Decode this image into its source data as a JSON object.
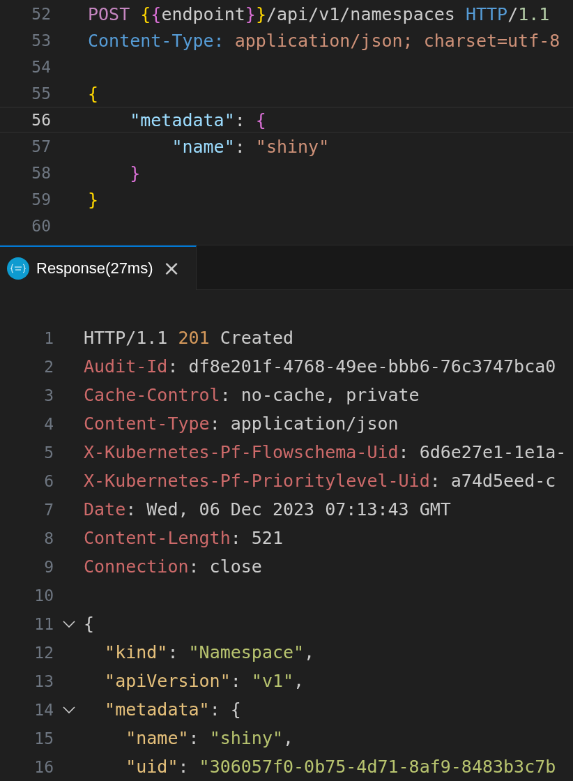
{
  "request_editor": {
    "lines": [
      {
        "number": "52",
        "current": false,
        "tokens": [
          {
            "kind": "keyword",
            "text": "POST "
          },
          {
            "kind": "brace1",
            "text": "{"
          },
          {
            "kind": "brace2",
            "text": "{"
          },
          {
            "kind": "plain",
            "text": "endpoint"
          },
          {
            "kind": "brace2",
            "text": "}"
          },
          {
            "kind": "brace1",
            "text": "}"
          },
          {
            "kind": "plain",
            "text": "/api/v1/namespaces "
          },
          {
            "kind": "type",
            "text": "HTTP"
          },
          {
            "kind": "plain",
            "text": "/"
          },
          {
            "kind": "number",
            "text": "1.1"
          }
        ]
      },
      {
        "number": "53",
        "current": false,
        "tokens": [
          {
            "kind": "type",
            "text": "Content-Type: "
          },
          {
            "kind": "string",
            "text": "application/json; charset=utf-8"
          }
        ]
      },
      {
        "number": "54",
        "current": false
      },
      {
        "number": "55",
        "current": false,
        "tokens": [
          {
            "kind": "brace1",
            "text": "{"
          }
        ]
      },
      {
        "number": "56",
        "current": true,
        "tokens": [
          {
            "kind": "key",
            "text": "    \"metadata\""
          },
          {
            "kind": "plain",
            "text": ": "
          },
          {
            "kind": "brace2",
            "text": "{"
          }
        ]
      },
      {
        "number": "57",
        "current": false,
        "tokens": [
          {
            "kind": "key",
            "text": "        \"name\""
          },
          {
            "kind": "plain",
            "text": ": "
          },
          {
            "kind": "string",
            "text": "\"shiny\""
          }
        ]
      },
      {
        "number": "58",
        "current": false,
        "tokens": [
          {
            "kind": "brace2",
            "text": "    }"
          }
        ]
      },
      {
        "number": "59",
        "current": false,
        "tokens": [
          {
            "kind": "brace1",
            "text": "}"
          }
        ]
      },
      {
        "number": "60",
        "current": false
      }
    ]
  },
  "tabs": [
    {
      "label": "Response(27ms)",
      "close": "×",
      "selected": true
    }
  ],
  "response_editor": {
    "lines": [
      {
        "number": "1",
        "tokens": [
          {
            "kind": "plain",
            "text": "HTTP/1.1 "
          },
          {
            "kind": "status",
            "text": "201"
          },
          {
            "kind": "plain",
            "text": " Created"
          }
        ]
      },
      {
        "number": "2",
        "tokens": [
          {
            "kind": "header",
            "text": "Audit-Id"
          },
          {
            "kind": "plain",
            "text": ": df8e201f-4768-49ee-bbb6-76c3747bca0"
          }
        ]
      },
      {
        "number": "3",
        "tokens": [
          {
            "kind": "header",
            "text": "Cache-Control"
          },
          {
            "kind": "plain",
            "text": ": no-cache, private"
          }
        ]
      },
      {
        "number": "4",
        "tokens": [
          {
            "kind": "header",
            "text": "Content-Type"
          },
          {
            "kind": "plain",
            "text": ": application/json"
          }
        ]
      },
      {
        "number": "5",
        "tokens": [
          {
            "kind": "header",
            "text": "X-Kubernetes-Pf-Flowschema-Uid"
          },
          {
            "kind": "plain",
            "text": ": 6d6e27e1-1e1a-"
          }
        ]
      },
      {
        "number": "6",
        "tokens": [
          {
            "kind": "header",
            "text": "X-Kubernetes-Pf-Prioritylevel-Uid"
          },
          {
            "kind": "plain",
            "text": ": a74d5eed-c"
          }
        ]
      },
      {
        "number": "7",
        "tokens": [
          {
            "kind": "header",
            "text": "Date"
          },
          {
            "kind": "plain",
            "text": ": Wed, 06 Dec 2023 07:13:43 GMT"
          }
        ]
      },
      {
        "number": "8",
        "tokens": [
          {
            "kind": "header",
            "text": "Content-Length"
          },
          {
            "kind": "plain",
            "text": ": 521"
          }
        ]
      },
      {
        "number": "9",
        "tokens": [
          {
            "kind": "header",
            "text": "Connection"
          },
          {
            "kind": "plain",
            "text": ": close"
          }
        ]
      },
      {
        "number": "10"
      },
      {
        "number": "11",
        "expanded": true,
        "tokens": [
          {
            "kind": "plain",
            "text": "{"
          }
        ]
      },
      {
        "number": "12",
        "tokens": [
          {
            "kind": "jkey",
            "text": "  \"kind\""
          },
          {
            "kind": "plain",
            "text": ": "
          },
          {
            "kind": "jstring",
            "text": "\"Namespace\""
          },
          {
            "kind": "plain",
            "text": ","
          }
        ]
      },
      {
        "number": "13",
        "tokens": [
          {
            "kind": "jkey",
            "text": "  \"apiVersion\""
          },
          {
            "kind": "plain",
            "text": ": "
          },
          {
            "kind": "jstring",
            "text": "\"v1\""
          },
          {
            "kind": "plain",
            "text": ","
          }
        ]
      },
      {
        "number": "14",
        "expanded": true,
        "tokens": [
          {
            "kind": "jkey",
            "text": "  \"metadata\""
          },
          {
            "kind": "plain",
            "text": ": {"
          }
        ]
      },
      {
        "number": "15",
        "tokens": [
          {
            "kind": "jkey",
            "text": "    \"name\""
          },
          {
            "kind": "plain",
            "text": ": "
          },
          {
            "kind": "jstring",
            "text": "\"shiny\""
          },
          {
            "kind": "plain",
            "text": ","
          }
        ]
      },
      {
        "number": "16",
        "tokens": [
          {
            "kind": "jkey",
            "text": "    \"uid\""
          },
          {
            "kind": "plain",
            "text": ": "
          },
          {
            "kind": "jstring",
            "text": "\"306057f0-0b75-4d71-8af9-8483b3c7b"
          }
        ]
      }
    ]
  }
}
